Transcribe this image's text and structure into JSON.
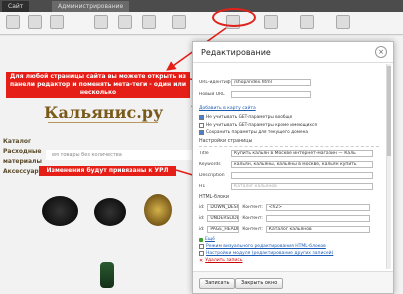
{
  "admin_bar": {
    "tab_site": "Сайт",
    "tab_admin": "Администрирование"
  },
  "site": {
    "logo_text": "Кальянис.ру",
    "menu": [
      "Каталог",
      "Расходные",
      "материалы",
      "Аксессуары"
    ],
    "nav_strip": "ем товары без количества"
  },
  "callouts": {
    "top": "Для любой страницы сайта вы можете открыть из панели редактор и поменять мета-теги - один или несколько",
    "bottom": "Изменения будут привязаны к УРЛ"
  },
  "modal": {
    "title": "Редактирование",
    "url_id_label": "URL-идентификатор страницы",
    "url_id_value": "/shop/index.html",
    "new_url_label": "Новый URL",
    "add_to_sitemap": "Добавить в карту сайта",
    "checkboxes": [
      {
        "label": "Не учитывать GET-параметры вообще",
        "checked": true
      },
      {
        "label": "Не учитывать GET-параметры кроме имеющихся",
        "checked": false
      },
      {
        "label": "Сохранить параметры для текущего домена",
        "checked": true
      }
    ],
    "page_settings": "Настройки страницы",
    "fields": [
      {
        "label": "Title",
        "value": "Купить кальян в Москве интернет-магазин — Каль"
      },
      {
        "label": "Keywords",
        "value": "кальян, кальяны, кальяны в москве, кальян купить"
      },
      {
        "label": "Description",
        "value": ""
      },
      {
        "label": "H1",
        "value": "",
        "placeholder": "Каталог кальянов"
      }
    ],
    "html_blocks_label": "HTML-блоки",
    "blocks": [
      {
        "id_label": "id:",
        "id": "DOWN_DESCRIPTION",
        "content_label": "Контент:",
        "content": "<h2>"
      },
      {
        "id_label": "id:",
        "id": "UNDERSLIDER",
        "content_label": "Контент:",
        "content": ""
      },
      {
        "id_label": "id:",
        "id": "PAGE_HEADER",
        "content_label": "Контент:",
        "content": "Каталог кальянов"
      }
    ],
    "more_link": "Ещё",
    "options": [
      "Режим визуального редактирования HTML-блоков",
      "Настройки модуля (редактирование других записей)"
    ],
    "delete_label": "Удалить запись",
    "save_button": "Записать",
    "close_button": "Закрыть окно"
  },
  "colors": {
    "accent_red": "#e51f17",
    "link_blue": "#1a5bb5"
  }
}
